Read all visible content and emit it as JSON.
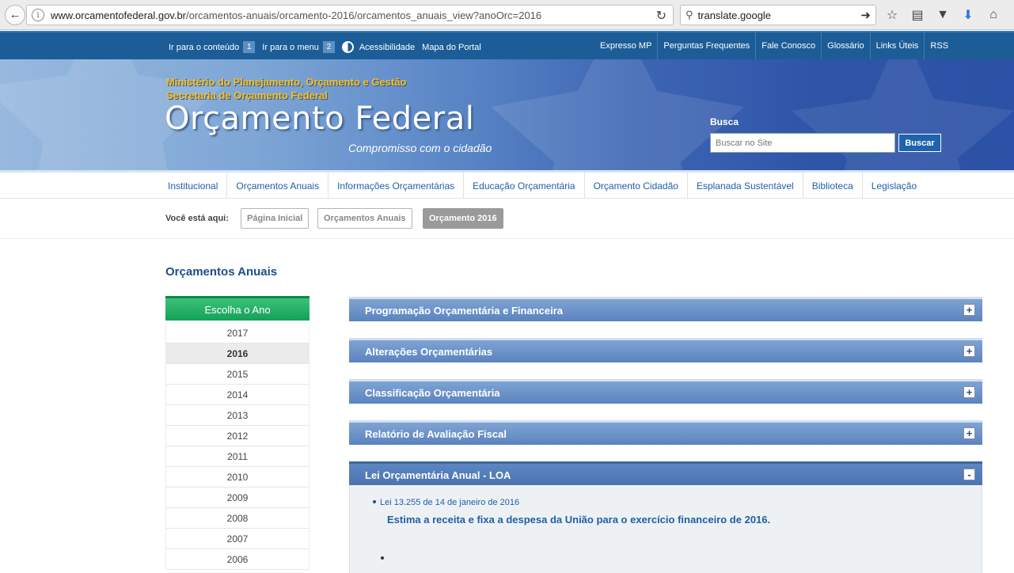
{
  "browser": {
    "url_host": "www.orcamentofederal.gov.br",
    "url_path": "/orcamentos-anuais/orcamento-2016/orcamentos_anuais_view?anoOrc=2016",
    "search_value": "translate.google"
  },
  "topbar": {
    "skip_content": "Ir para o conteúdo",
    "skip_content_key": "1",
    "skip_menu": "Ir para o menu",
    "skip_menu_key": "2",
    "accessibility": "Acessibilidade",
    "sitemap": "Mapa do Portal",
    "links": [
      "Expresso MP",
      "Perguntas Frequentes",
      "Fale Conosco",
      "Glossário",
      "Links Úteis",
      "RSS"
    ]
  },
  "banner": {
    "ministry_line1": "Ministério do Planejamento, Orçamento e Gestão",
    "ministry_line2": "Secretaria de Orçamento Federal",
    "brand": "Orçamento Federal",
    "tagline": "Compromisso com o cidadão",
    "search_label": "Busca",
    "search_placeholder": "Buscar no Site",
    "search_button": "Buscar"
  },
  "menu": [
    "Institucional",
    "Orçamentos Anuais",
    "Informações Orçamentárias",
    "Educação Orçamentária",
    "Orçamento Cidadão",
    "Esplanada Sustentável",
    "Biblioteca",
    "Legislação"
  ],
  "breadcrumb": {
    "label": "Você está aqui:",
    "items": [
      "Página Inicial",
      "Orçamentos Anuais",
      "Orçamento 2016"
    ]
  },
  "page_title": "Orçamentos Anuais",
  "years": {
    "heading": "Escolha o Ano",
    "selected": "2016",
    "list": [
      "2017",
      "2016",
      "2015",
      "2014",
      "2013",
      "2012",
      "2011",
      "2010",
      "2009",
      "2008",
      "2007",
      "2006"
    ]
  },
  "accordion": {
    "sections": [
      {
        "title": "Programação Orçamentária e Financeira",
        "toggle": "+"
      },
      {
        "title": "Alterações Orçamentárias",
        "toggle": "+"
      },
      {
        "title": "Classificação Orçamentária",
        "toggle": "+"
      },
      {
        "title": "Relatório de Avaliação Fiscal",
        "toggle": "+"
      },
      {
        "title": "Lei Orçamentária Anual - LOA",
        "toggle": "-"
      }
    ],
    "loa": {
      "law_link": "Lei 13.255 de 14 de janeiro de 2016",
      "law_description": "Estima a receita e fixa a despesa da União para o exercício financeiro de 2016."
    }
  }
}
